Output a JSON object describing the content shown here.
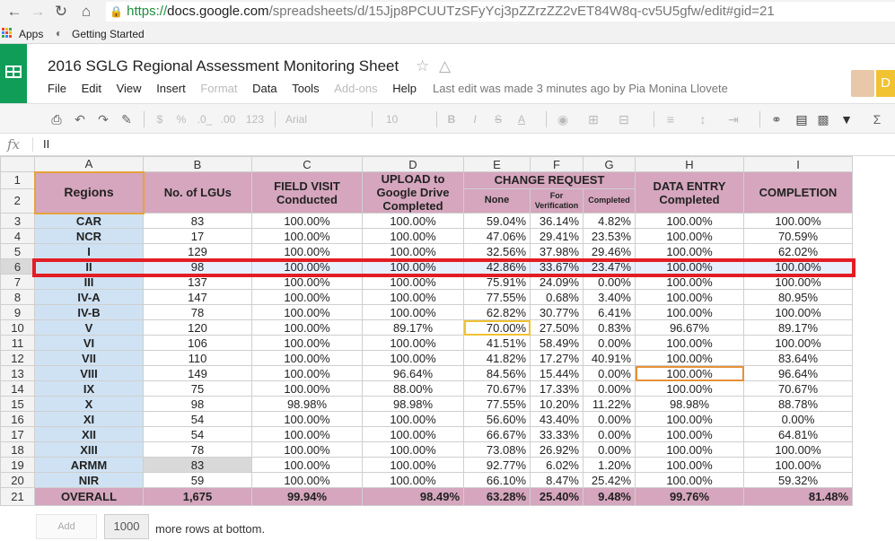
{
  "browser": {
    "url_scheme": "https://",
    "url_host": "docs.google.com",
    "url_path": "/spreadsheets/d/15Jjp8PCUUTzSFyYcj3pZZrzZZ2vET84W8q-cv5U5gfw/edit#gid=21",
    "bookmarks": [
      "Apps",
      "Getting Started"
    ]
  },
  "doc": {
    "title": "2016 SGLG Regional Assessment Monitoring Sheet",
    "last_edit": "Last edit was made 3 minutes ago by Pia Monina Llovete",
    "avatar_letter": "D"
  },
  "menu": [
    "File",
    "Edit",
    "View",
    "Insert",
    "Format",
    "Data",
    "Tools",
    "Add-ons",
    "Help"
  ],
  "menu_disabled": [
    "Format",
    "Add-ons"
  ],
  "toolbar": {
    "currency": "$",
    "percent": "%",
    "dec_less": ".0_",
    "dec_more": ".00",
    "more_formats": "123",
    "font": "Arial",
    "font_size": "10",
    "bold": "B",
    "italic": "I",
    "strike": "S",
    "text_color": "A"
  },
  "formula_bar": {
    "fx": "fx",
    "value": "II"
  },
  "columns": [
    "A",
    "B",
    "C",
    "D",
    "E",
    "F",
    "G",
    "H",
    "I"
  ],
  "header": {
    "regions": "Regions",
    "lgus": "No. of LGUs",
    "field_visit": "FIELD VISIT Conducted",
    "upload": "UPLOAD to Google Drive Completed",
    "change_request": "CHANGE REQUEST",
    "none": "None",
    "for_verification": "For Verification",
    "completed": "Completed",
    "data_entry": "DATA ENTRY Completed",
    "completion": "COMPLETION"
  },
  "rows": [
    {
      "n": "3",
      "region": "CAR",
      "lgus": "83",
      "field": "100.00%",
      "upload": "100.00%",
      "none": "59.04%",
      "verif": "36.14%",
      "comp": "4.82%",
      "entry": "100.00%",
      "completion": "100.00%"
    },
    {
      "n": "4",
      "region": "NCR",
      "lgus": "17",
      "field": "100.00%",
      "upload": "100.00%",
      "none": "47.06%",
      "verif": "29.41%",
      "comp": "23.53%",
      "entry": "100.00%",
      "completion": "70.59%"
    },
    {
      "n": "5",
      "region": "I",
      "lgus": "129",
      "field": "100.00%",
      "upload": "100.00%",
      "none": "32.56%",
      "verif": "37.98%",
      "comp": "29.46%",
      "entry": "100.00%",
      "completion": "62.02%"
    },
    {
      "n": "6",
      "region": "II",
      "lgus": "98",
      "field": "100.00%",
      "upload": "100.00%",
      "none": "42.86%",
      "verif": "33.67%",
      "comp": "23.47%",
      "entry": "100.00%",
      "completion": "100.00%"
    },
    {
      "n": "7",
      "region": "III",
      "lgus": "137",
      "field": "100.00%",
      "upload": "100.00%",
      "none": "75.91%",
      "verif": "24.09%",
      "comp": "0.00%",
      "entry": "100.00%",
      "completion": "100.00%"
    },
    {
      "n": "8",
      "region": "IV-A",
      "lgus": "147",
      "field": "100.00%",
      "upload": "100.00%",
      "none": "77.55%",
      "verif": "0.68%",
      "comp": "3.40%",
      "entry": "100.00%",
      "completion": "80.95%"
    },
    {
      "n": "9",
      "region": "IV-B",
      "lgus": "78",
      "field": "100.00%",
      "upload": "100.00%",
      "none": "62.82%",
      "verif": "30.77%",
      "comp": "6.41%",
      "entry": "100.00%",
      "completion": "100.00%"
    },
    {
      "n": "10",
      "region": "V",
      "lgus": "120",
      "field": "100.00%",
      "upload": "89.17%",
      "none": "70.00%",
      "verif": "27.50%",
      "comp": "0.83%",
      "entry": "96.67%",
      "completion": "89.17%"
    },
    {
      "n": "11",
      "region": "VI",
      "lgus": "106",
      "field": "100.00%",
      "upload": "100.00%",
      "none": "41.51%",
      "verif": "58.49%",
      "comp": "0.00%",
      "entry": "100.00%",
      "completion": "100.00%"
    },
    {
      "n": "12",
      "region": "VII",
      "lgus": "110",
      "field": "100.00%",
      "upload": "100.00%",
      "none": "41.82%",
      "verif": "17.27%",
      "comp": "40.91%",
      "entry": "100.00%",
      "completion": "83.64%"
    },
    {
      "n": "13",
      "region": "VIII",
      "lgus": "149",
      "field": "100.00%",
      "upload": "96.64%",
      "none": "84.56%",
      "verif": "15.44%",
      "comp": "0.00%",
      "entry": "100.00%",
      "completion": "96.64%"
    },
    {
      "n": "14",
      "region": "IX",
      "lgus": "75",
      "field": "100.00%",
      "upload": "88.00%",
      "none": "70.67%",
      "verif": "17.33%",
      "comp": "0.00%",
      "entry": "100.00%",
      "completion": "70.67%"
    },
    {
      "n": "15",
      "region": "X",
      "lgus": "98",
      "field": "98.98%",
      "upload": "98.98%",
      "none": "77.55%",
      "verif": "10.20%",
      "comp": "11.22%",
      "entry": "98.98%",
      "completion": "88.78%"
    },
    {
      "n": "16",
      "region": "XI",
      "lgus": "54",
      "field": "100.00%",
      "upload": "100.00%",
      "none": "56.60%",
      "verif": "43.40%",
      "comp": "0.00%",
      "entry": "100.00%",
      "completion": "0.00%"
    },
    {
      "n": "17",
      "region": "XII",
      "lgus": "54",
      "field": "100.00%",
      "upload": "100.00%",
      "none": "66.67%",
      "verif": "33.33%",
      "comp": "0.00%",
      "entry": "100.00%",
      "completion": "64.81%"
    },
    {
      "n": "18",
      "region": "XIII",
      "lgus": "78",
      "field": "100.00%",
      "upload": "100.00%",
      "none": "73.08%",
      "verif": "26.92%",
      "comp": "0.00%",
      "entry": "100.00%",
      "completion": "100.00%"
    },
    {
      "n": "19",
      "region": "ARMM",
      "lgus": "83",
      "field": "100.00%",
      "upload": "100.00%",
      "none": "92.77%",
      "verif": "6.02%",
      "comp": "1.20%",
      "entry": "100.00%",
      "completion": "100.00%"
    },
    {
      "n": "20",
      "region": "NIR",
      "lgus": "59",
      "field": "100.00%",
      "upload": "100.00%",
      "none": "66.10%",
      "verif": "8.47%",
      "comp": "25.42%",
      "entry": "100.00%",
      "completion": "59.32%"
    }
  ],
  "overall": {
    "n": "21",
    "region": "OVERALL",
    "lgus": "1,675",
    "field": "99.94%",
    "upload": "98.49%",
    "none": "63.28%",
    "verif": "25.40%",
    "comp": "9.48%",
    "entry": "99.76%",
    "completion": "81.48%"
  },
  "footer": {
    "add_label": "Add",
    "rows_value": "1000",
    "more_text": "more rows at bottom."
  },
  "colors": {
    "header_pink": "#d5a6bd",
    "region_blue": "#cfe2f3",
    "highlight_red": "#e31d24",
    "sheets_green": "#0f9d58"
  }
}
